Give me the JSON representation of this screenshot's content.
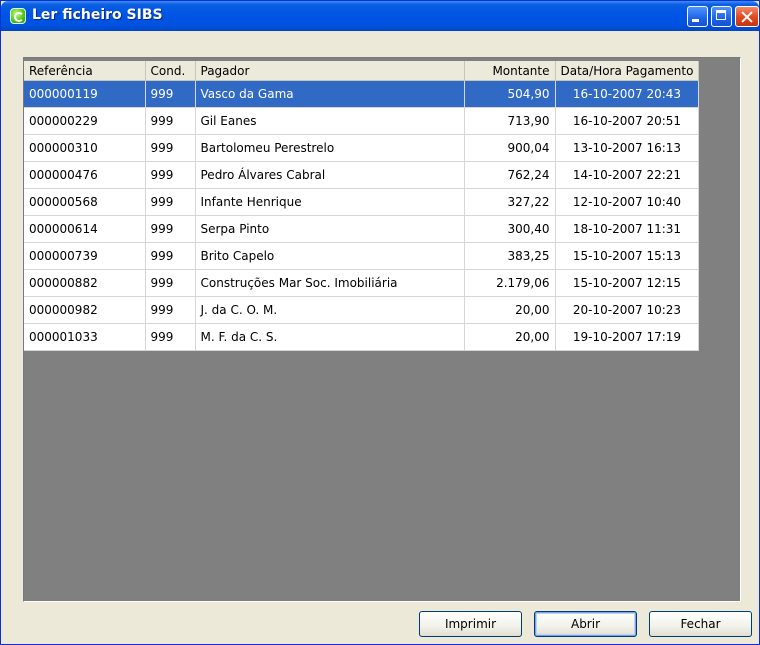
{
  "window": {
    "title": "Ler ficheiro SIBS"
  },
  "table": {
    "columns": [
      "Referência",
      "Cond.",
      "Pagador",
      "Montante",
      "Data/Hora Pagamento"
    ],
    "selected_row": 0,
    "rows": [
      [
        "000000119",
        "999",
        "Vasco da Gama",
        "504,90",
        "16-10-2007 20:43"
      ],
      [
        "000000229",
        "999",
        "Gil Eanes",
        "713,90",
        "16-10-2007 20:51"
      ],
      [
        "000000310",
        "999",
        "Bartolomeu Perestrelo",
        "900,04",
        "13-10-2007 16:13"
      ],
      [
        "000000476",
        "999",
        "Pedro Álvares Cabral",
        "762,24",
        "14-10-2007 22:21"
      ],
      [
        "000000568",
        "999",
        "Infante Henrique",
        "327,22",
        "12-10-2007 10:40"
      ],
      [
        "000000614",
        "999",
        "Serpa Pinto",
        "300,40",
        "18-10-2007 11:31"
      ],
      [
        "000000739",
        "999",
        "Brito Capelo",
        "383,25",
        "15-10-2007 15:13"
      ],
      [
        "000000882",
        "999",
        "Construções Mar Soc. Imobiliária",
        "2.179,06",
        "15-10-2007 12:15"
      ],
      [
        "000000982",
        "999",
        "J. da C. O. M.",
        "20,00",
        "20-10-2007 10:23"
      ],
      [
        "000001033",
        "999",
        "M. F. da C. S.",
        "20,00",
        "19-10-2007 17:19"
      ]
    ]
  },
  "buttons": {
    "print": "Imprimir",
    "open": "Abrir",
    "close": "Fechar"
  },
  "colors": {
    "titlebar": "#0055e5",
    "selection": "#316ac5",
    "grid_background": "#808080",
    "window_face": "#ece9d8"
  },
  "icons": {
    "app": "sibs-app-icon",
    "minimize": "minimize-icon",
    "maximize": "maximize-icon",
    "close": "close-icon"
  }
}
